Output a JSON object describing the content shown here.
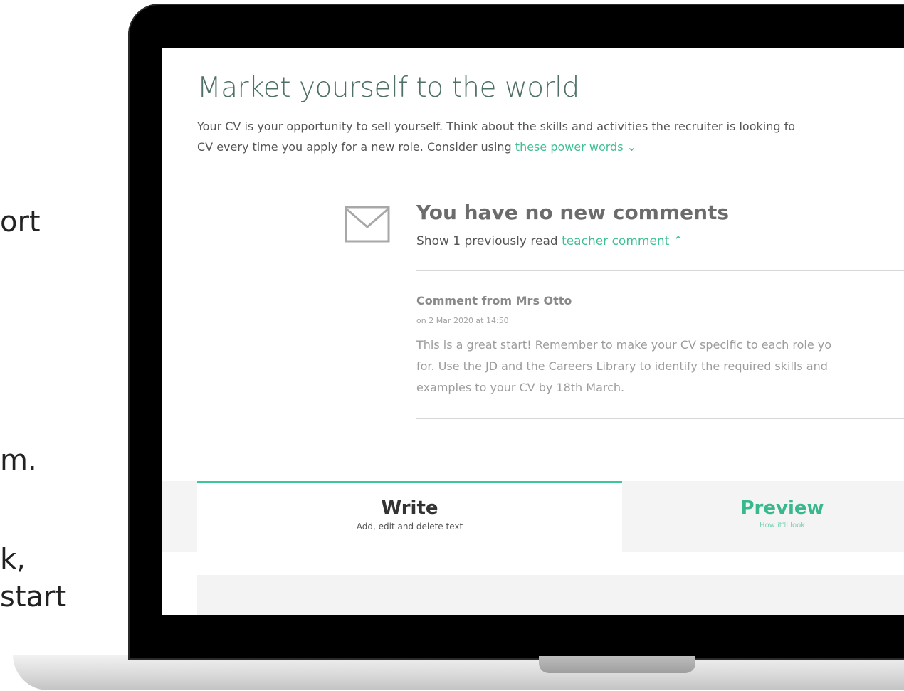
{
  "side_text": [
    "ort",
    "m.",
    "k,",
    "start"
  ],
  "page": {
    "title": "Market yourself to the world",
    "intro_line1": "Your CV is your opportunity to sell yourself. Think about the skills and activities the recruiter is looking fo",
    "intro_line2": "CV every time you apply for a new role. Consider using ",
    "power_words_link": "these power words ⌄"
  },
  "comments": {
    "heading": "You have no new comments",
    "sub_prefix": "Show 1 previously read ",
    "sub_link": "teacher comment ⌃",
    "author": "Comment from Mrs Otto",
    "date": "on 2 Mar 2020 at 14:50",
    "body_line1": "This is a great start! Remember to make your CV specific to each role yo",
    "body_line2": "for. Use the JD and the Careers Library to identify the required skills and",
    "body_line3": "examples to your CV by 18th March."
  },
  "tabs": {
    "write": {
      "label": "Write",
      "desc": "Add, edit and delete text"
    },
    "preview": {
      "label": "Preview",
      "desc": "How it'll look"
    }
  },
  "colors": {
    "accent": "#3cc69b",
    "title": "#4f7068",
    "link": "#3fbf96"
  },
  "icons": {
    "mail": "envelope-icon"
  }
}
